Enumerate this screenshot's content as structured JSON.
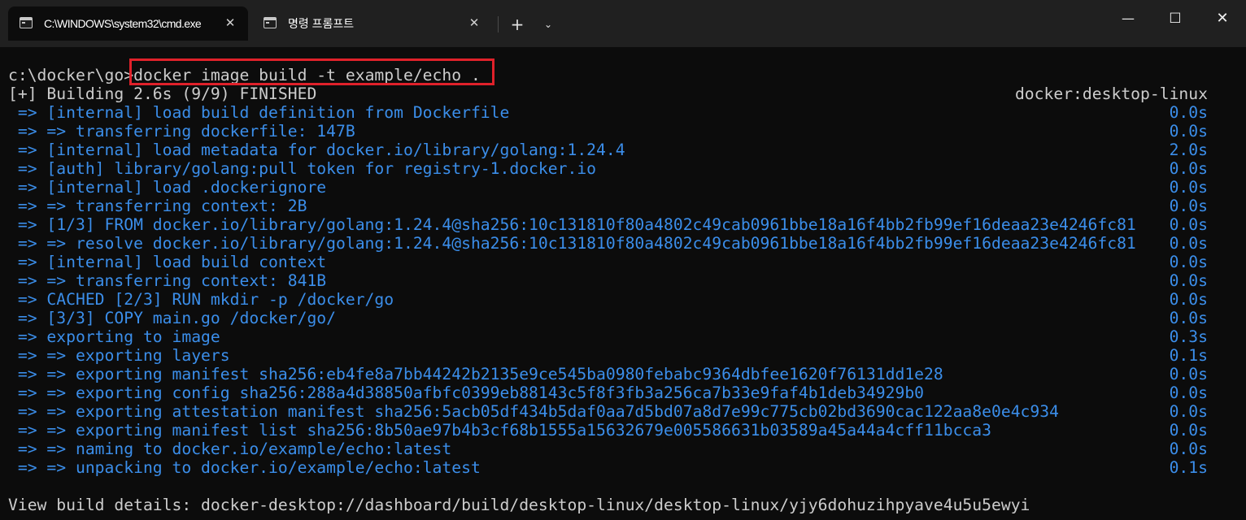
{
  "titlebar": {
    "tabs": [
      {
        "title": "C:\\WINDOWS\\system32\\cmd.exe",
        "close": "✕"
      },
      {
        "title": "명령 프롬프트",
        "close": "✕"
      }
    ],
    "new_tab": "+",
    "dropdown": "⌄",
    "window_controls": {
      "minimize": "—",
      "maximize": "☐",
      "close": "✕"
    }
  },
  "terminal": {
    "prompt": "c:\\docker\\go>",
    "command": "docker image build -t example/echo .",
    "build_status": "[+] Building 2.6s (9/9) FINISHED",
    "builder": "docker:desktop-linux",
    "steps": [
      {
        "text": " => [internal] load build definition from Dockerfile",
        "time": "0.0s"
      },
      {
        "text": " => => transferring dockerfile: 147B",
        "time": "0.0s"
      },
      {
        "text": " => [internal] load metadata for docker.io/library/golang:1.24.4",
        "time": "2.0s"
      },
      {
        "text": " => [auth] library/golang:pull token for registry-1.docker.io",
        "time": "0.0s"
      },
      {
        "text": " => [internal] load .dockerignore",
        "time": "0.0s"
      },
      {
        "text": " => => transferring context: 2B",
        "time": "0.0s"
      },
      {
        "text": " => [1/3] FROM docker.io/library/golang:1.24.4@sha256:10c131810f80a4802c49cab0961bbe18a16f4bb2fb99ef16deaa23e4246fc81",
        "time": "0.0s"
      },
      {
        "text": " => => resolve docker.io/library/golang:1.24.4@sha256:10c131810f80a4802c49cab0961bbe18a16f4bb2fb99ef16deaa23e4246fc81",
        "time": "0.0s"
      },
      {
        "text": " => [internal] load build context",
        "time": "0.0s"
      },
      {
        "text": " => => transferring context: 841B",
        "time": "0.0s"
      },
      {
        "text": " => CACHED [2/3] RUN mkdir -p /docker/go",
        "time": "0.0s"
      },
      {
        "text": " => [3/3] COPY main.go /docker/go/",
        "time": "0.0s"
      },
      {
        "text": " => exporting to image",
        "time": "0.3s"
      },
      {
        "text": " => => exporting layers",
        "time": "0.1s"
      },
      {
        "text": " => => exporting manifest sha256:eb4fe8a7bb44242b2135e9ce545ba0980febabc9364dbfee1620f76131dd1e28",
        "time": "0.0s"
      },
      {
        "text": " => => exporting config sha256:288a4d38850afbfc0399eb88143c5f8f3fb3a256ca7b33e9faf4b1deb34929b0",
        "time": "0.0s"
      },
      {
        "text": " => => exporting attestation manifest sha256:5acb05df434b5daf0aa7d5bd07a8d7e99c775cb02bd3690cac122aa8e0e4c934",
        "time": "0.0s"
      },
      {
        "text": " => => exporting manifest list sha256:8b50ae97b4b3cf68b1555a15632679e005586631b03589a45a44a4cff11bcca3",
        "time": "0.0s"
      },
      {
        "text": " => => naming to docker.io/example/echo:latest",
        "time": "0.0s"
      },
      {
        "text": " => => unpacking to docker.io/example/echo:latest",
        "time": "0.1s"
      }
    ],
    "details": "View build details: docker-desktop://dashboard/build/desktop-linux/desktop-linux/yjy6dohuzihpyave4u5u5ewyi"
  },
  "colors": {
    "background": "#0c0c0c",
    "titlebar": "#202020",
    "text": "#cccccc",
    "step_text": "#3b8eea",
    "highlight_border": "#e0212a"
  }
}
